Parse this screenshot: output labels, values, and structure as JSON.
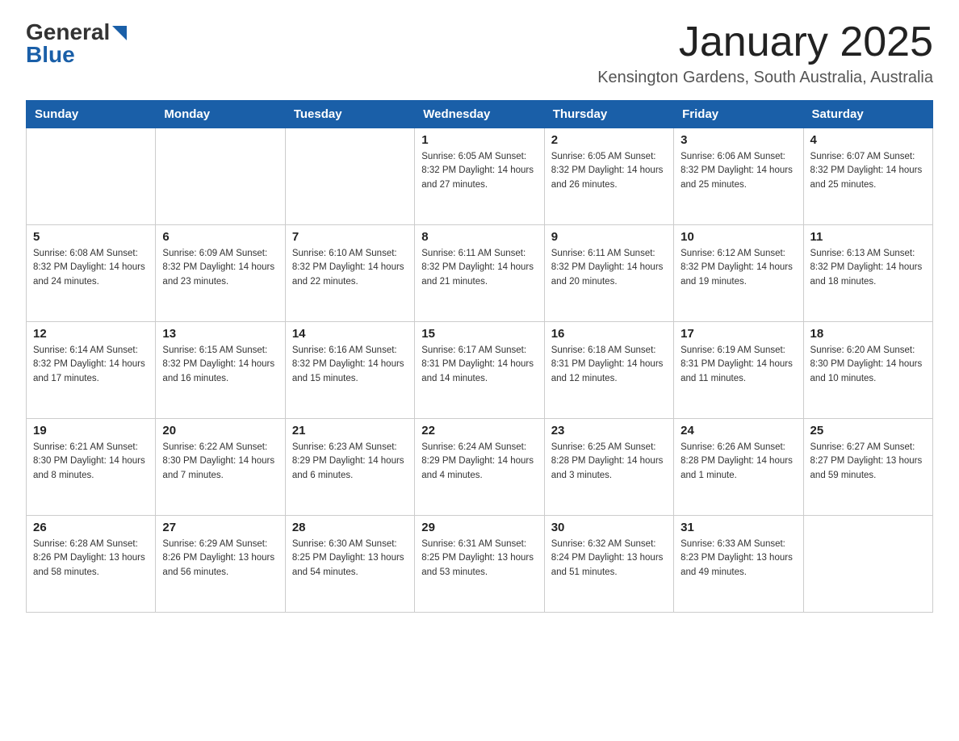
{
  "header": {
    "logo_general": "General",
    "logo_blue": "Blue",
    "title": "January 2025",
    "subtitle": "Kensington Gardens, South Australia, Australia"
  },
  "days_of_week": [
    "Sunday",
    "Monday",
    "Tuesday",
    "Wednesday",
    "Thursday",
    "Friday",
    "Saturday"
  ],
  "weeks": [
    [
      {
        "day": "",
        "info": ""
      },
      {
        "day": "",
        "info": ""
      },
      {
        "day": "",
        "info": ""
      },
      {
        "day": "1",
        "info": "Sunrise: 6:05 AM\nSunset: 8:32 PM\nDaylight: 14 hours\nand 27 minutes."
      },
      {
        "day": "2",
        "info": "Sunrise: 6:05 AM\nSunset: 8:32 PM\nDaylight: 14 hours\nand 26 minutes."
      },
      {
        "day": "3",
        "info": "Sunrise: 6:06 AM\nSunset: 8:32 PM\nDaylight: 14 hours\nand 25 minutes."
      },
      {
        "day": "4",
        "info": "Sunrise: 6:07 AM\nSunset: 8:32 PM\nDaylight: 14 hours\nand 25 minutes."
      }
    ],
    [
      {
        "day": "5",
        "info": "Sunrise: 6:08 AM\nSunset: 8:32 PM\nDaylight: 14 hours\nand 24 minutes."
      },
      {
        "day": "6",
        "info": "Sunrise: 6:09 AM\nSunset: 8:32 PM\nDaylight: 14 hours\nand 23 minutes."
      },
      {
        "day": "7",
        "info": "Sunrise: 6:10 AM\nSunset: 8:32 PM\nDaylight: 14 hours\nand 22 minutes."
      },
      {
        "day": "8",
        "info": "Sunrise: 6:11 AM\nSunset: 8:32 PM\nDaylight: 14 hours\nand 21 minutes."
      },
      {
        "day": "9",
        "info": "Sunrise: 6:11 AM\nSunset: 8:32 PM\nDaylight: 14 hours\nand 20 minutes."
      },
      {
        "day": "10",
        "info": "Sunrise: 6:12 AM\nSunset: 8:32 PM\nDaylight: 14 hours\nand 19 minutes."
      },
      {
        "day": "11",
        "info": "Sunrise: 6:13 AM\nSunset: 8:32 PM\nDaylight: 14 hours\nand 18 minutes."
      }
    ],
    [
      {
        "day": "12",
        "info": "Sunrise: 6:14 AM\nSunset: 8:32 PM\nDaylight: 14 hours\nand 17 minutes."
      },
      {
        "day": "13",
        "info": "Sunrise: 6:15 AM\nSunset: 8:32 PM\nDaylight: 14 hours\nand 16 minutes."
      },
      {
        "day": "14",
        "info": "Sunrise: 6:16 AM\nSunset: 8:32 PM\nDaylight: 14 hours\nand 15 minutes."
      },
      {
        "day": "15",
        "info": "Sunrise: 6:17 AM\nSunset: 8:31 PM\nDaylight: 14 hours\nand 14 minutes."
      },
      {
        "day": "16",
        "info": "Sunrise: 6:18 AM\nSunset: 8:31 PM\nDaylight: 14 hours\nand 12 minutes."
      },
      {
        "day": "17",
        "info": "Sunrise: 6:19 AM\nSunset: 8:31 PM\nDaylight: 14 hours\nand 11 minutes."
      },
      {
        "day": "18",
        "info": "Sunrise: 6:20 AM\nSunset: 8:30 PM\nDaylight: 14 hours\nand 10 minutes."
      }
    ],
    [
      {
        "day": "19",
        "info": "Sunrise: 6:21 AM\nSunset: 8:30 PM\nDaylight: 14 hours\nand 8 minutes."
      },
      {
        "day": "20",
        "info": "Sunrise: 6:22 AM\nSunset: 8:30 PM\nDaylight: 14 hours\nand 7 minutes."
      },
      {
        "day": "21",
        "info": "Sunrise: 6:23 AM\nSunset: 8:29 PM\nDaylight: 14 hours\nand 6 minutes."
      },
      {
        "day": "22",
        "info": "Sunrise: 6:24 AM\nSunset: 8:29 PM\nDaylight: 14 hours\nand 4 minutes."
      },
      {
        "day": "23",
        "info": "Sunrise: 6:25 AM\nSunset: 8:28 PM\nDaylight: 14 hours\nand 3 minutes."
      },
      {
        "day": "24",
        "info": "Sunrise: 6:26 AM\nSunset: 8:28 PM\nDaylight: 14 hours\nand 1 minute."
      },
      {
        "day": "25",
        "info": "Sunrise: 6:27 AM\nSunset: 8:27 PM\nDaylight: 13 hours\nand 59 minutes."
      }
    ],
    [
      {
        "day": "26",
        "info": "Sunrise: 6:28 AM\nSunset: 8:26 PM\nDaylight: 13 hours\nand 58 minutes."
      },
      {
        "day": "27",
        "info": "Sunrise: 6:29 AM\nSunset: 8:26 PM\nDaylight: 13 hours\nand 56 minutes."
      },
      {
        "day": "28",
        "info": "Sunrise: 6:30 AM\nSunset: 8:25 PM\nDaylight: 13 hours\nand 54 minutes."
      },
      {
        "day": "29",
        "info": "Sunrise: 6:31 AM\nSunset: 8:25 PM\nDaylight: 13 hours\nand 53 minutes."
      },
      {
        "day": "30",
        "info": "Sunrise: 6:32 AM\nSunset: 8:24 PM\nDaylight: 13 hours\nand 51 minutes."
      },
      {
        "day": "31",
        "info": "Sunrise: 6:33 AM\nSunset: 8:23 PM\nDaylight: 13 hours\nand 49 minutes."
      },
      {
        "day": "",
        "info": ""
      }
    ]
  ]
}
